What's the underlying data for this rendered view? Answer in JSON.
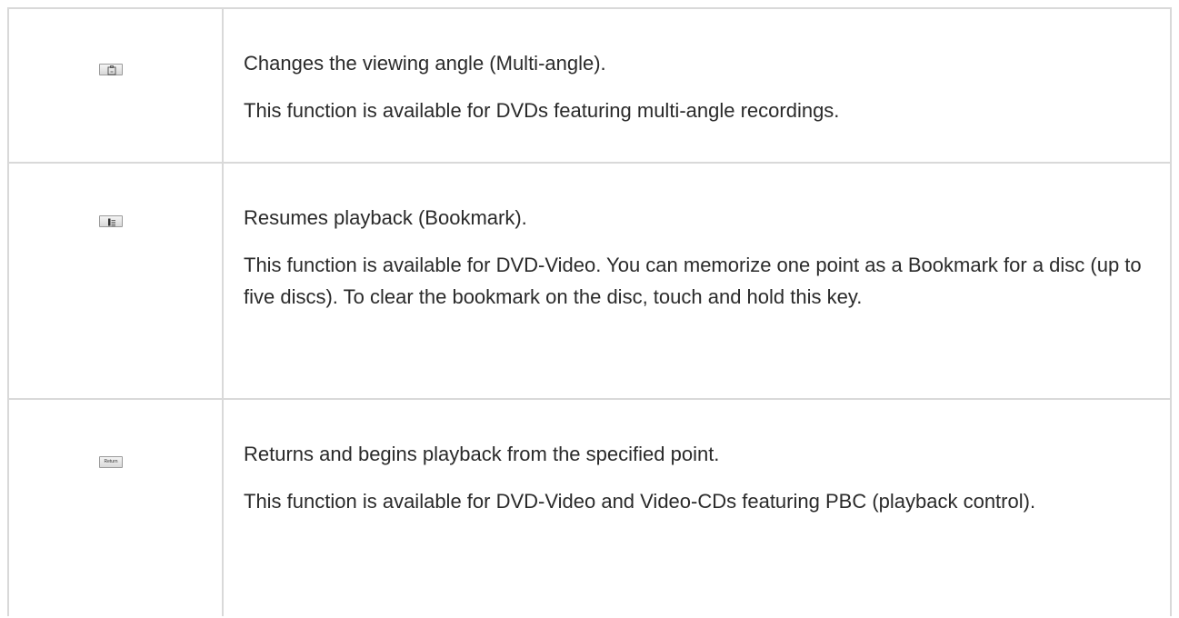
{
  "rows": [
    {
      "icon": "multi-angle-key-icon",
      "title": "Changes the viewing angle (Multi-angle).",
      "description": "This function is available for DVDs featuring multi-angle recordings."
    },
    {
      "icon": "bookmark-key-icon",
      "title": "Resumes playback (Bookmark).",
      "description": "This function is available for DVD-Video. You can memorize one point as a Bookmark for a disc (up to five discs). To clear the bookmark on the disc, touch and hold this key."
    },
    {
      "icon": "return-key-icon",
      "key_label": "Return",
      "title": "Returns and begins playback from the specified point.",
      "description": "This function is available for DVD-Video and Video-CDs featuring PBC (playback control)."
    }
  ]
}
